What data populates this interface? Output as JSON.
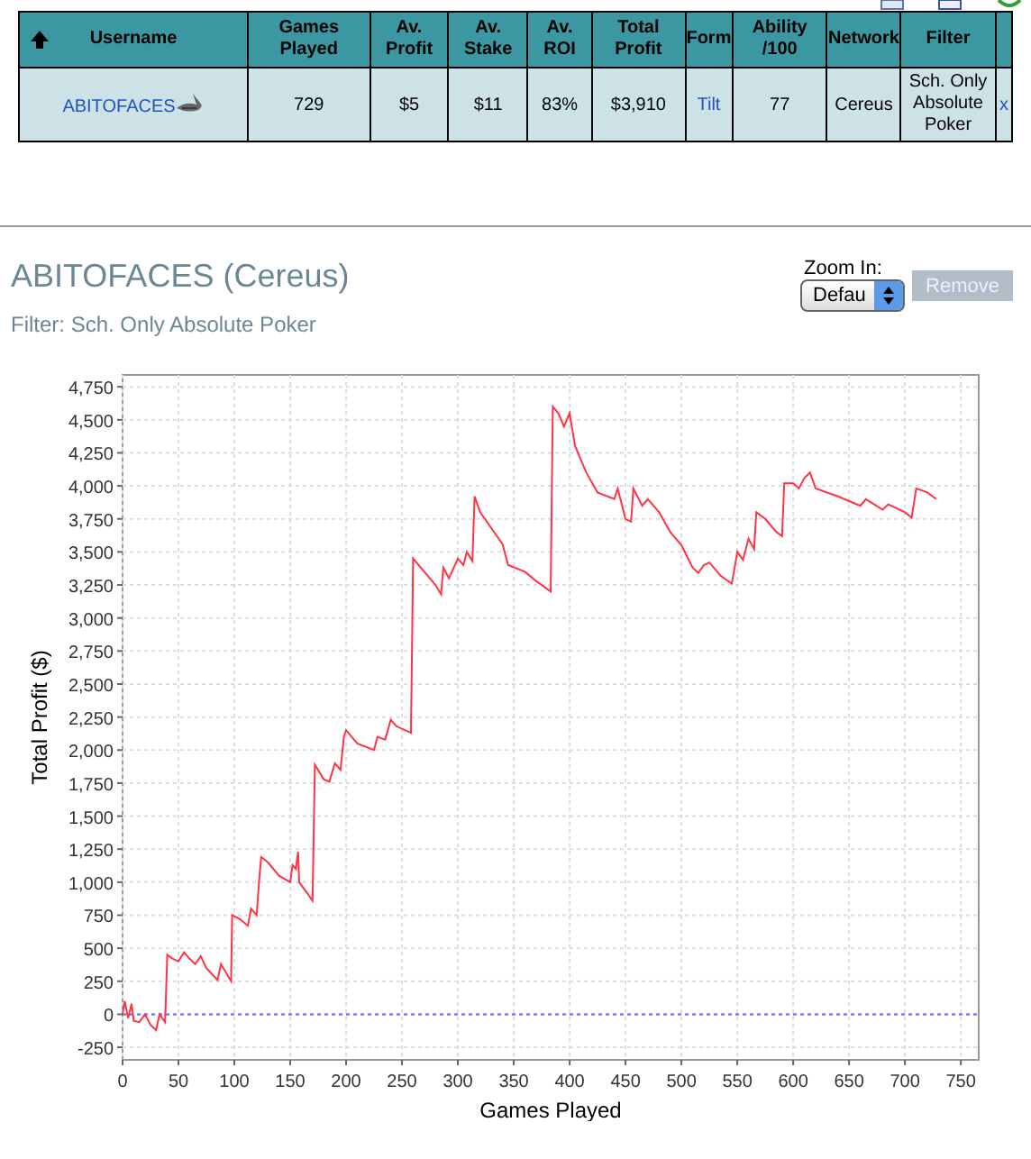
{
  "table": {
    "columns": [
      "Username",
      "Games Played",
      "Av. Profit",
      "Av. Stake",
      "Av. ROI",
      "Total Profit",
      "Form",
      "Ability /100",
      "Network",
      "Filter"
    ],
    "rows": [
      {
        "cells": [
          {
            "text": "ABITOFACES",
            "kind": "player"
          },
          {
            "text": "729",
            "kind": "text"
          },
          {
            "text": "$5",
            "kind": "text"
          },
          {
            "text": "$11",
            "kind": "text"
          },
          {
            "text": "83%",
            "kind": "text"
          },
          {
            "text": "$3,910",
            "kind": "text"
          },
          {
            "text": "Tilt",
            "kind": "link"
          },
          {
            "text": "77",
            "kind": "text"
          },
          {
            "text": "Cereus",
            "kind": "text"
          },
          {
            "text": "Sch. Only Absolute Poker",
            "kind": "text"
          },
          {
            "text": "x",
            "kind": "link"
          }
        ]
      }
    ]
  },
  "panel": {
    "title": "ABITOFACES (Cereus)",
    "filter": "Filter: Sch. Only Absolute Poker",
    "zoom_label": "Zoom In:",
    "zoom_value": "Defau",
    "remove_button": "Remove",
    "remove_disabled": true
  },
  "chart_data": {
    "type": "line",
    "xlabel": "Games Played",
    "ylabel": "Total Profit ($)",
    "xlim": [
      0,
      766
    ],
    "ylim": [
      -345,
      4840
    ],
    "xticks": [
      0,
      50,
      100,
      150,
      200,
      250,
      300,
      350,
      400,
      450,
      500,
      550,
      600,
      650,
      700,
      750
    ],
    "yticks": [
      {
        "value": -250,
        "label": "-250"
      },
      {
        "value": 0,
        "label": "0"
      },
      {
        "value": 250,
        "label": "250"
      },
      {
        "value": 500,
        "label": "500"
      },
      {
        "value": 750,
        "label": "750"
      },
      {
        "value": 1000,
        "label": "1,000"
      },
      {
        "value": 1250,
        "label": "1,250"
      },
      {
        "value": 1500,
        "label": "1,500"
      },
      {
        "value": 1750,
        "label": "1,750"
      },
      {
        "value": 2000,
        "label": "2,000"
      },
      {
        "value": 2250,
        "label": "2,250"
      },
      {
        "value": 2500,
        "label": "2,500"
      },
      {
        "value": 2750,
        "label": "2,750"
      },
      {
        "value": 3000,
        "label": "3,000"
      },
      {
        "value": 3250,
        "label": "3,250"
      },
      {
        "value": 3500,
        "label": "3,500"
      },
      {
        "value": 3750,
        "label": "3,750"
      },
      {
        "value": 4000,
        "label": "4,000"
      },
      {
        "value": 4250,
        "label": "4,250"
      },
      {
        "value": 4500,
        "label": "4,500"
      },
      {
        "value": 4750,
        "label": "4,750"
      }
    ],
    "x": [
      0,
      2,
      5,
      8,
      10,
      15,
      20,
      25,
      30,
      33,
      38,
      40,
      45,
      50,
      55,
      60,
      65,
      70,
      75,
      85,
      88,
      97,
      98,
      105,
      112,
      115,
      120,
      122,
      124,
      130,
      140,
      150,
      152,
      155,
      157,
      158,
      165,
      170,
      172,
      180,
      185,
      190,
      195,
      198,
      200,
      210,
      225,
      228,
      235,
      240,
      245,
      258,
      260,
      270,
      280,
      285,
      287,
      292,
      300,
      305,
      308,
      313,
      315,
      320,
      340,
      345,
      360,
      370,
      383,
      385,
      390,
      395,
      400,
      405,
      415,
      425,
      440,
      443,
      450,
      455,
      457,
      465,
      470,
      480,
      490,
      500,
      510,
      515,
      520,
      525,
      535,
      545,
      550,
      555,
      560,
      565,
      567,
      575,
      585,
      590,
      592,
      600,
      605,
      610,
      615,
      620,
      640,
      660,
      665,
      680,
      685,
      700,
      706,
      710,
      720,
      728
    ],
    "grid": true,
    "series": [
      {
        "color": "#ff3344",
        "values": [
          0,
          100,
          -30,
          80,
          -50,
          -60,
          0,
          -80,
          -120,
          0,
          -60,
          450,
          420,
          400,
          470,
          420,
          380,
          440,
          350,
          260,
          380,
          250,
          750,
          720,
          670,
          800,
          750,
          1000,
          1190,
          1150,
          1050,
          1000,
          1130,
          1100,
          1230,
          1000,
          920,
          860,
          1890,
          1780,
          1760,
          1900,
          1850,
          2100,
          2150,
          2050,
          2000,
          2100,
          2080,
          2230,
          2180,
          2130,
          3450,
          3350,
          3250,
          3180,
          3380,
          3300,
          3450,
          3400,
          3500,
          3430,
          3920,
          3800,
          3560,
          3400,
          3350,
          3280,
          3200,
          4600,
          4550,
          4450,
          4550,
          4300,
          4100,
          3950,
          3900,
          3980,
          3750,
          3730,
          3980,
          3850,
          3900,
          3800,
          3650,
          3550,
          3380,
          3340,
          3400,
          3420,
          3320,
          3260,
          3500,
          3440,
          3600,
          3520,
          3800,
          3750,
          3650,
          3620,
          4020,
          4020,
          3980,
          4060,
          4100,
          3980,
          3920,
          3850,
          3900,
          3820,
          3860,
          3800,
          3760,
          3980,
          3950,
          3900
        ]
      }
    ],
    "ref_lines": [
      {
        "axis": "y",
        "value": 0,
        "color": "#6666ff"
      }
    ]
  }
}
